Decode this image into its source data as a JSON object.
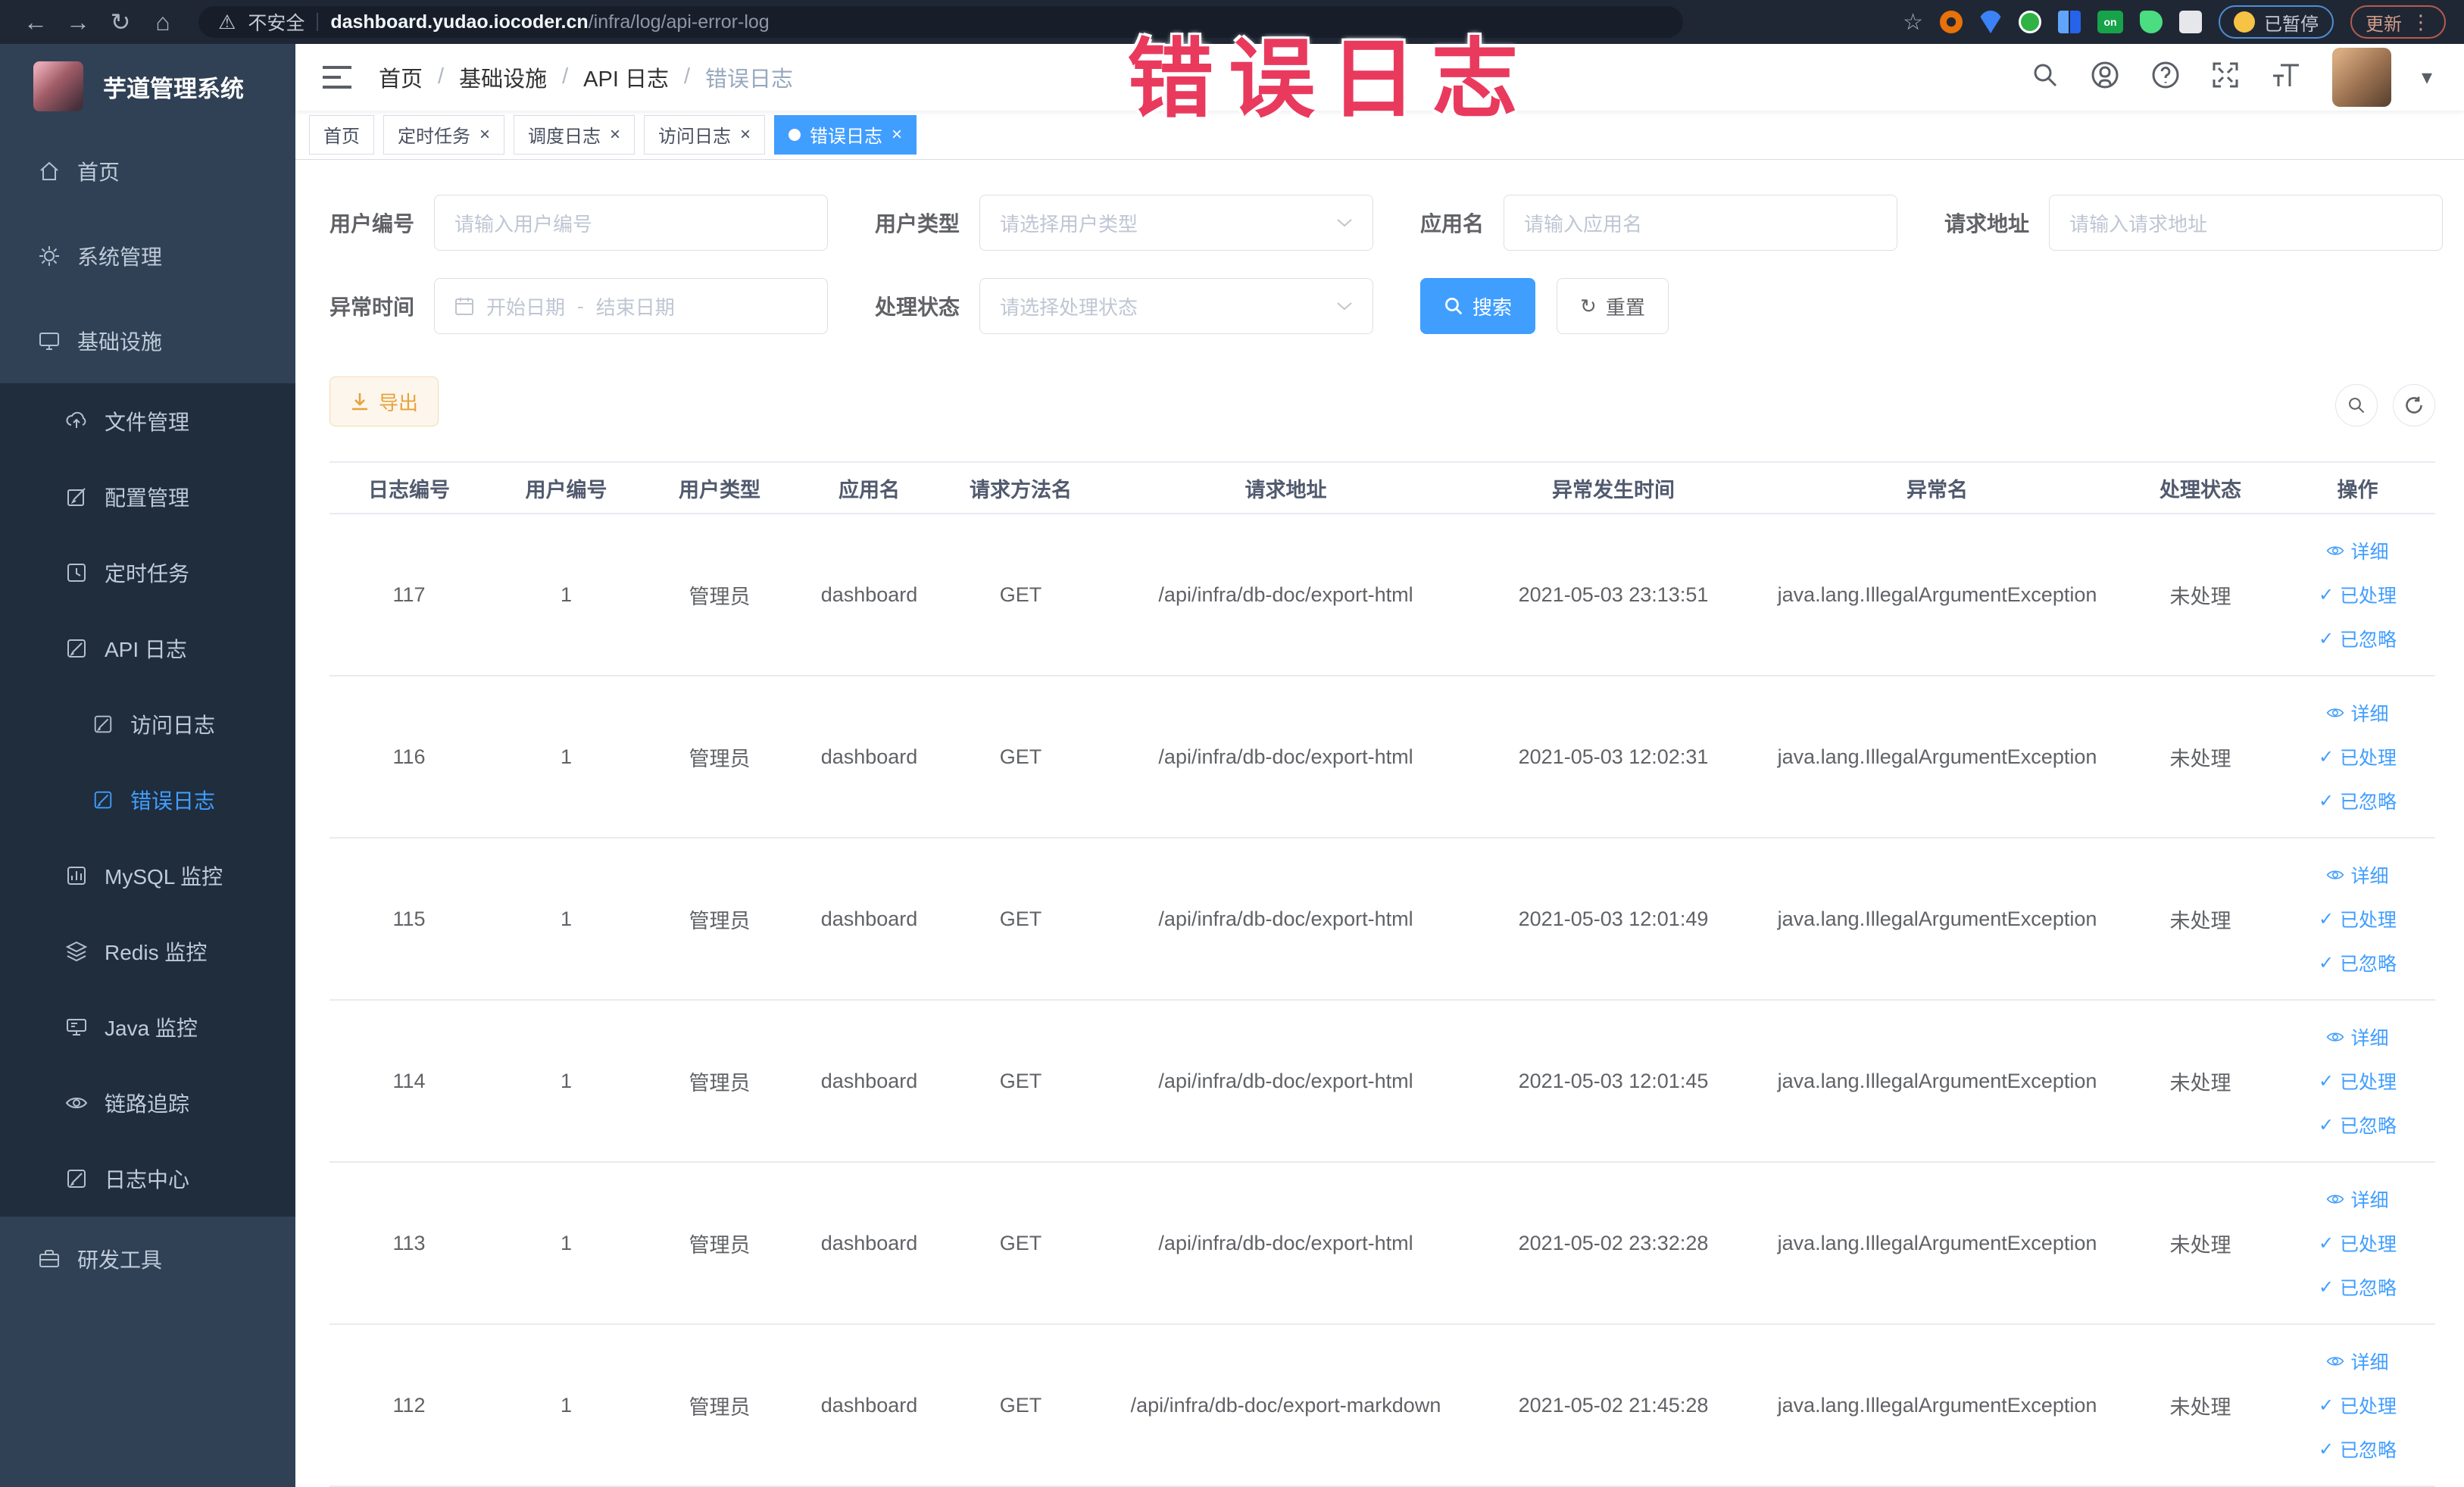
{
  "browser": {
    "back": "←",
    "forward": "→",
    "reload": "↻",
    "home": "⌂",
    "warning": "⚠",
    "security_label": "不安全",
    "url_host": "dashboard.yudao.iocoder.cn",
    "url_path": "/infra/log/api-error-log",
    "bookmark_star": "☆",
    "ext_on_label": "on",
    "paused_label": "已暂停",
    "update_label": "更新",
    "menu_dots": "⋮"
  },
  "annotation": {
    "text": "错误日志",
    "color": "#e93a5e"
  },
  "sidebar": {
    "title": "芋道管理系统",
    "items": [
      {
        "label": "首页"
      },
      {
        "label": "系统管理"
      },
      {
        "label": "基础设施"
      },
      {
        "label": "文件管理"
      },
      {
        "label": "配置管理"
      },
      {
        "label": "定时任务"
      },
      {
        "label": "API 日志"
      },
      {
        "label": "访问日志"
      },
      {
        "label": "错误日志",
        "active": true
      },
      {
        "label": "MySQL 监控"
      },
      {
        "label": "Redis 监控"
      },
      {
        "label": "Java 监控"
      },
      {
        "label": "链路追踪"
      },
      {
        "label": "日志中心"
      },
      {
        "label": "研发工具"
      }
    ]
  },
  "navbar": {
    "breadcrumb": [
      "首页",
      "基础设施",
      "API 日志",
      "错误日志"
    ],
    "separator": "/",
    "caret": "▾"
  },
  "tags": {
    "home": "首页",
    "t1": "定时任务",
    "t2": "调度日志",
    "t3": "访问日志",
    "t4": "错误日志"
  },
  "icons": {
    "close_x": "×",
    "check": "✓",
    "reset": "↻"
  },
  "filters": {
    "user_id": {
      "label": "用户编号",
      "placeholder": "请输入用户编号"
    },
    "user_type": {
      "label": "用户类型",
      "placeholder": "请选择用户类型"
    },
    "app_name": {
      "label": "应用名",
      "placeholder": "请输入应用名"
    },
    "request_url": {
      "label": "请求地址",
      "placeholder": "请输入请求地址"
    },
    "exception_time": {
      "label": "异常时间",
      "start_placeholder": "开始日期",
      "range_separator": "-",
      "end_placeholder": "结束日期"
    },
    "process_status": {
      "label": "处理状态",
      "placeholder": "请选择处理状态"
    },
    "search_label": "搜索",
    "reset_label": "重置"
  },
  "toolbar": {
    "export_label": "导出"
  },
  "table": {
    "columns": [
      "日志编号",
      "用户编号",
      "用户类型",
      "应用名",
      "请求方法名",
      "请求地址",
      "异常发生时间",
      "异常名",
      "处理状态",
      "操作"
    ],
    "actions": {
      "detail": "详细",
      "processed": "已处理",
      "ignored": "已忽略"
    },
    "rows": [
      {
        "id": "117",
        "user_id": "1",
        "user_type": "管理员",
        "app_name": "dashboard",
        "method": "GET",
        "url": "/api/infra/db-doc/export-html",
        "time": "2021-05-03 23:13:51",
        "exception": "java.lang.IllegalArgumentException",
        "status": "未处理"
      },
      {
        "id": "116",
        "user_id": "1",
        "user_type": "管理员",
        "app_name": "dashboard",
        "method": "GET",
        "url": "/api/infra/db-doc/export-html",
        "time": "2021-05-03 12:02:31",
        "exception": "java.lang.IllegalArgumentException",
        "status": "未处理"
      },
      {
        "id": "115",
        "user_id": "1",
        "user_type": "管理员",
        "app_name": "dashboard",
        "method": "GET",
        "url": "/api/infra/db-doc/export-html",
        "time": "2021-05-03 12:01:49",
        "exception": "java.lang.IllegalArgumentException",
        "status": "未处理"
      },
      {
        "id": "114",
        "user_id": "1",
        "user_type": "管理员",
        "app_name": "dashboard",
        "method": "GET",
        "url": "/api/infra/db-doc/export-html",
        "time": "2021-05-03 12:01:45",
        "exception": "java.lang.IllegalArgumentException",
        "status": "未处理"
      },
      {
        "id": "113",
        "user_id": "1",
        "user_type": "管理员",
        "app_name": "dashboard",
        "method": "GET",
        "url": "/api/infra/db-doc/export-html",
        "time": "2021-05-02 23:32:28",
        "exception": "java.lang.IllegalArgumentException",
        "status": "未处理"
      },
      {
        "id": "112",
        "user_id": "1",
        "user_type": "管理员",
        "app_name": "dashboard",
        "method": "GET",
        "url": "/api/infra/db-doc/export-markdown",
        "time": "2021-05-02 21:45:28",
        "exception": "java.lang.IllegalArgumentException",
        "status": "未处理"
      }
    ]
  }
}
